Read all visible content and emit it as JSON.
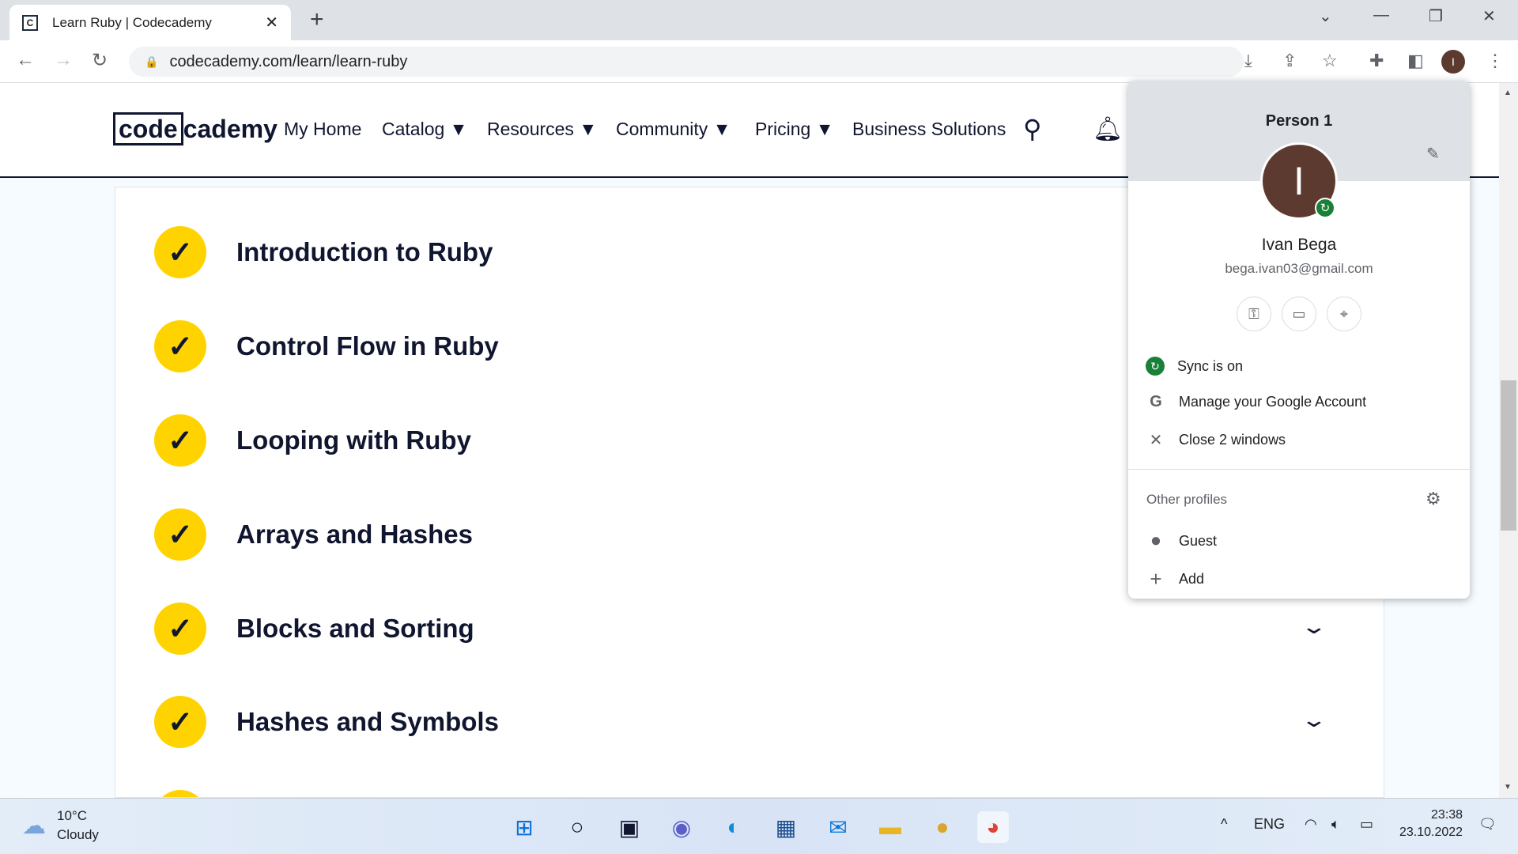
{
  "browser": {
    "tab_title": "Learn Ruby | Codecademy",
    "favicon": "C",
    "url": "codecademy.com/learn/learn-ruby",
    "profile_initial": "I"
  },
  "site": {
    "logo_code": "code",
    "logo_cademy": "cademy",
    "nav": [
      "My Home",
      "Catalog ▼",
      "Resources ▼",
      "Community ▼",
      "Pricing ▼",
      "Business Solutions"
    ]
  },
  "modules": [
    {
      "title": "Introduction to Ruby",
      "completed": true
    },
    {
      "title": "Control Flow in Ruby",
      "completed": true
    },
    {
      "title": "Looping with Ruby",
      "completed": true
    },
    {
      "title": "Arrays and Hashes",
      "completed": true
    },
    {
      "title": "Blocks and Sorting",
      "completed": true
    },
    {
      "title": "Hashes and Symbols",
      "completed": true
    }
  ],
  "profile_menu": {
    "profile_name": "Person 1",
    "avatar_initial": "I",
    "user_name": "Ivan Bega",
    "email": "bega.ivan03@gmail.com",
    "sync": "Sync is on",
    "manage": "Manage your Google Account",
    "close": "Close 2 windows",
    "other_profiles": "Other profiles",
    "guest": "Guest",
    "add": "Add",
    "sync_color": "#188038"
  },
  "taskbar": {
    "temperature": "10°C",
    "weather": "Cloudy",
    "language": "ENG",
    "time": "23:38",
    "date": "23.10.2022"
  },
  "colors": {
    "accent_yellow": "#ffd300",
    "navy": "#10162f"
  }
}
